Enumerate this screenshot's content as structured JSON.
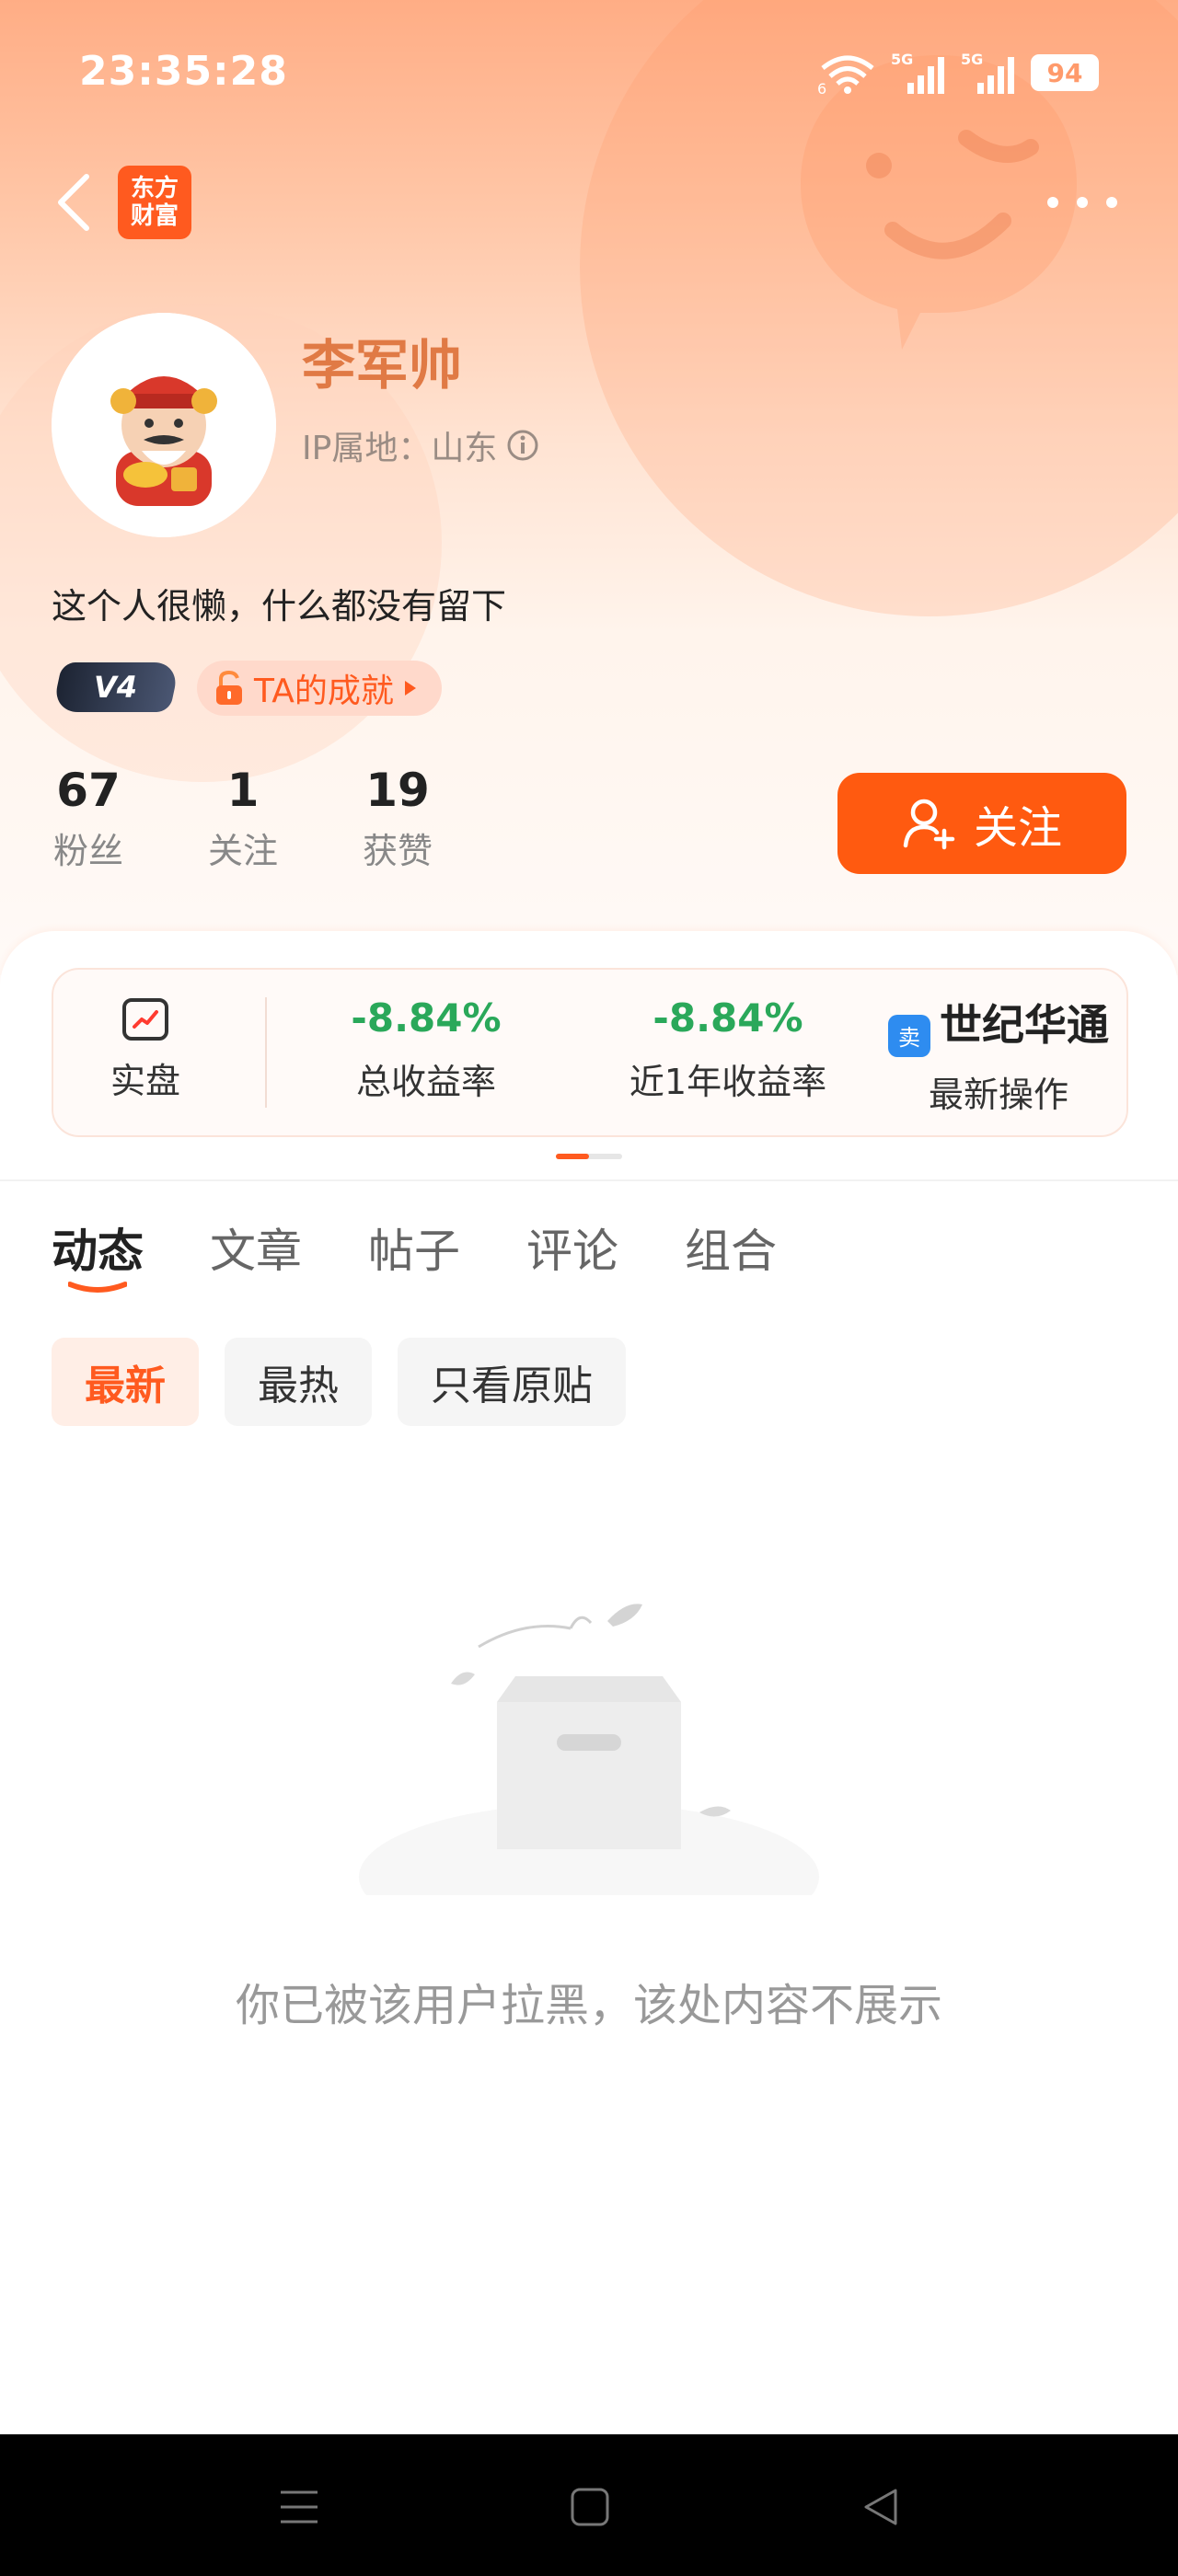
{
  "status_bar": {
    "time": "23:35:28",
    "wifi_label": "6",
    "sim1_label": "5G",
    "sim2_label": "5G",
    "battery": "94"
  },
  "nav": {
    "logo_line1": "东方",
    "logo_line2": "财富"
  },
  "profile": {
    "name": "李军帅",
    "ip_location": "IP属地：山东",
    "bio": "这个人很懒，什么都没有留下",
    "level": "V4",
    "achievement_label": "TA的成就"
  },
  "stats": [
    {
      "value": "67",
      "label": "粉丝"
    },
    {
      "value": "1",
      "label": "关注"
    },
    {
      "value": "19",
      "label": "获赞"
    }
  ],
  "follow_button": "关注",
  "performance": {
    "tab_label": "实盘",
    "total_return_value": "-8.84%",
    "total_return_label": "总收益率",
    "year_return_value": "-8.84%",
    "year_return_label": "近1年收益率",
    "latest_tag": "卖",
    "latest_stock": "世纪华通",
    "latest_label": "最新操作"
  },
  "tabs": [
    "动态",
    "文章",
    "帖子",
    "评论",
    "组合"
  ],
  "filters": [
    "最新",
    "最热",
    "只看原贴"
  ],
  "empty_message": "你已被该用户拉黑，该处内容不展示",
  "colors": {
    "accent": "#ff5a1f",
    "gain_negative": "#2aa85a",
    "name": "#e07a45"
  }
}
